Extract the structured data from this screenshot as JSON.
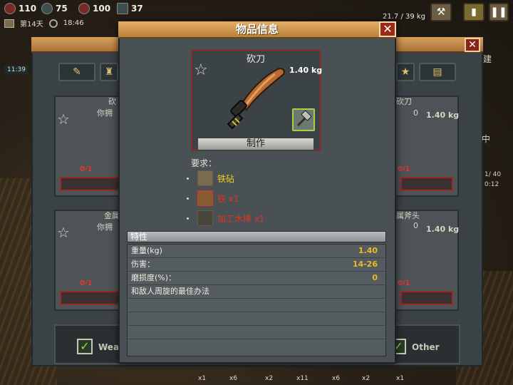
{
  "hud": {
    "health": "110",
    "food": "75",
    "water": "100",
    "energy": "37",
    "day": "第14天",
    "time": "18:46",
    "side_time": "11:39",
    "carry": "21.7 / 39 kg"
  },
  "back": {
    "card_top_left_title": "砍",
    "card_top_left_sub": "你拥",
    "card_top_right_title": "砍刀",
    "card_top_right_sub": "0",
    "card_top_right_weight": "1.40 kg",
    "card_bottom_left_title": "金属",
    "card_bottom_left_sub": "你拥",
    "card_bottom_right_title": "属斧头",
    "card_bottom_right_sub": "0",
    "card_bottom_right_weight": "1.40 kg",
    "count_a": "0/1",
    "count_b": "0/1",
    "count_c": "0/1",
    "count_d": "0/1",
    "right_edge_1": "建",
    "right_edge_2": "中",
    "right_edge_3": "1/ 40",
    "right_edge_4": "0:12",
    "cat_weapons": "Wea",
    "cat_other": "Other",
    "bottom_counts": [
      "x1",
      "x6",
      "x2",
      "x11",
      "x6",
      "x2",
      "x1"
    ]
  },
  "dialog": {
    "title": "物品信息",
    "item_name": "砍刀",
    "item_weight": "1.40 kg",
    "make_label": "制作",
    "req_label": "要求：",
    "requirements": [
      {
        "text": "铁砧",
        "color": "#f0d020"
      },
      {
        "text": "铁 x1",
        "color": "#e03228"
      },
      {
        "text": "加工木棒 x1",
        "color": "#e03228"
      }
    ],
    "props_title": "特性",
    "props": [
      {
        "label": "重量(kg)",
        "value": "1.40"
      },
      {
        "label": "伤害：",
        "value": "14-26"
      },
      {
        "label": "磨损度(%)：",
        "value": "0"
      },
      {
        "label": "和敌人周旋的最佳办法",
        "value": ""
      }
    ]
  },
  "colors": {
    "accent": "#e6ad64",
    "value": "#f0b828",
    "missing": "#e03228",
    "available": "#f0d020"
  }
}
